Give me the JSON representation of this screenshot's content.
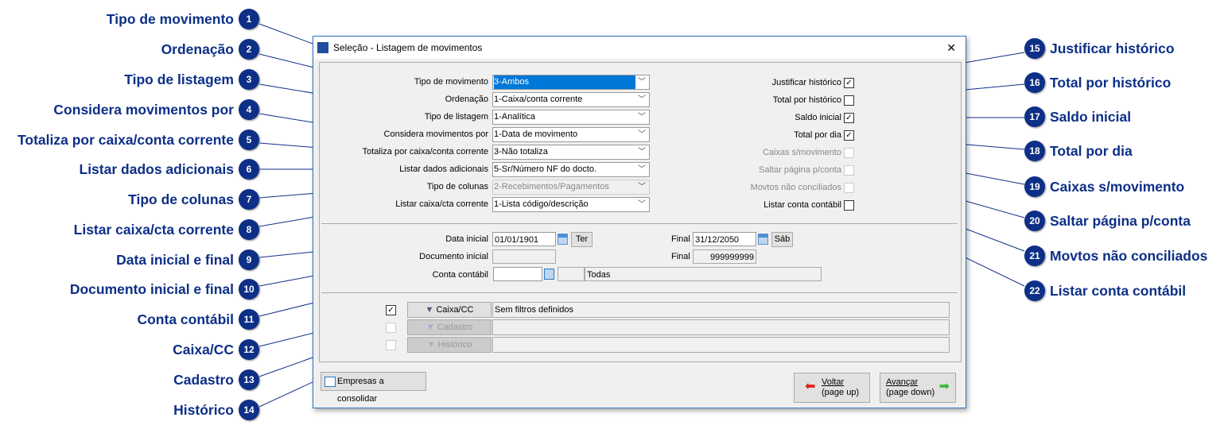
{
  "callouts_left": [
    {
      "n": "1",
      "label": "Tipo de movimento"
    },
    {
      "n": "2",
      "label": "Ordenação"
    },
    {
      "n": "3",
      "label": "Tipo de listagem"
    },
    {
      "n": "4",
      "label": "Considera movimentos por"
    },
    {
      "n": "5",
      "label": "Totaliza por caixa/conta corrente"
    },
    {
      "n": "6",
      "label": "Listar dados adicionais"
    },
    {
      "n": "7",
      "label": "Tipo de colunas"
    },
    {
      "n": "8",
      "label": "Listar caixa/cta corrente"
    },
    {
      "n": "9",
      "label": "Data inicial e final"
    },
    {
      "n": "10",
      "label": "Documento inicial e final"
    },
    {
      "n": "11",
      "label": "Conta contábil"
    },
    {
      "n": "12",
      "label": "Caixa/CC"
    },
    {
      "n": "13",
      "label": "Cadastro"
    },
    {
      "n": "14",
      "label": "Histórico"
    }
  ],
  "callouts_right": [
    {
      "n": "15",
      "label": "Justificar histórico"
    },
    {
      "n": "16",
      "label": "Total por histórico"
    },
    {
      "n": "17",
      "label": "Saldo inicial"
    },
    {
      "n": "18",
      "label": "Total por dia"
    },
    {
      "n": "19",
      "label": "Caixas s/movimento"
    },
    {
      "n": "20",
      "label": "Saltar página p/conta"
    },
    {
      "n": "21",
      "label": "Movtos não conciliados"
    },
    {
      "n": "22",
      "label": "Listar conta contábil"
    }
  ],
  "dialog": {
    "title": "Seleção - Listagem de movimentos",
    "close": "✕",
    "combos": [
      {
        "label": "Tipo de movimento",
        "value": "3-Ambos"
      },
      {
        "label": "Ordenação",
        "value": "1-Caixa/conta corrente"
      },
      {
        "label": "Tipo de listagem",
        "value": "1-Analítica"
      },
      {
        "label": "Considera movimentos por",
        "value": "1-Data de movimento"
      },
      {
        "label": "Totaliza por caixa/conta corrente",
        "value": "3-Não totaliza"
      },
      {
        "label": "Listar dados adicionais",
        "value": "5-Sr/Número NF do docto."
      },
      {
        "label": "Tipo de colunas",
        "value": "2-Recebimentos/Pagamentos"
      },
      {
        "label": "Listar caixa/cta corrente",
        "value": "1-Lista código/descrição"
      }
    ],
    "options": [
      {
        "label": "Justificar histórico",
        "mark": "✓"
      },
      {
        "label": "Total por histórico",
        "mark": ""
      },
      {
        "label": "Saldo inicial",
        "mark": "✓"
      },
      {
        "label": "Total por dia",
        "mark": "✓"
      },
      {
        "label": "Caixas s/movimento",
        "mark": ""
      },
      {
        "label": "Saltar página p/conta",
        "mark": ""
      },
      {
        "label": "Movtos não conciliados",
        "mark": ""
      },
      {
        "label": "Listar conta contábil",
        "mark": ""
      }
    ],
    "date_label": "Data inicial",
    "date_start": "01/01/1901",
    "day_start": "Ter",
    "final_label": "Final",
    "date_end": "31/12/2050",
    "day_end": "Sáb",
    "doc_label": "Documento inicial",
    "doc_start": "",
    "doc_end": "999999999",
    "conta_label": "Conta contábil",
    "conta_value": "",
    "conta_desc": "Todas",
    "filters": [
      {
        "mark": "✓",
        "button": "Caixa/CC",
        "value": "Sem filtros definidos"
      },
      {
        "mark": "",
        "button": "Cadastro",
        "value": ""
      },
      {
        "mark": "",
        "button": "Histórico",
        "value": ""
      }
    ],
    "empresas": "Empresas a consolidar",
    "voltar": "Voltar",
    "voltar_sub": "(page up)",
    "avancar": "Avançar",
    "avancar_sub": "(page down)"
  }
}
